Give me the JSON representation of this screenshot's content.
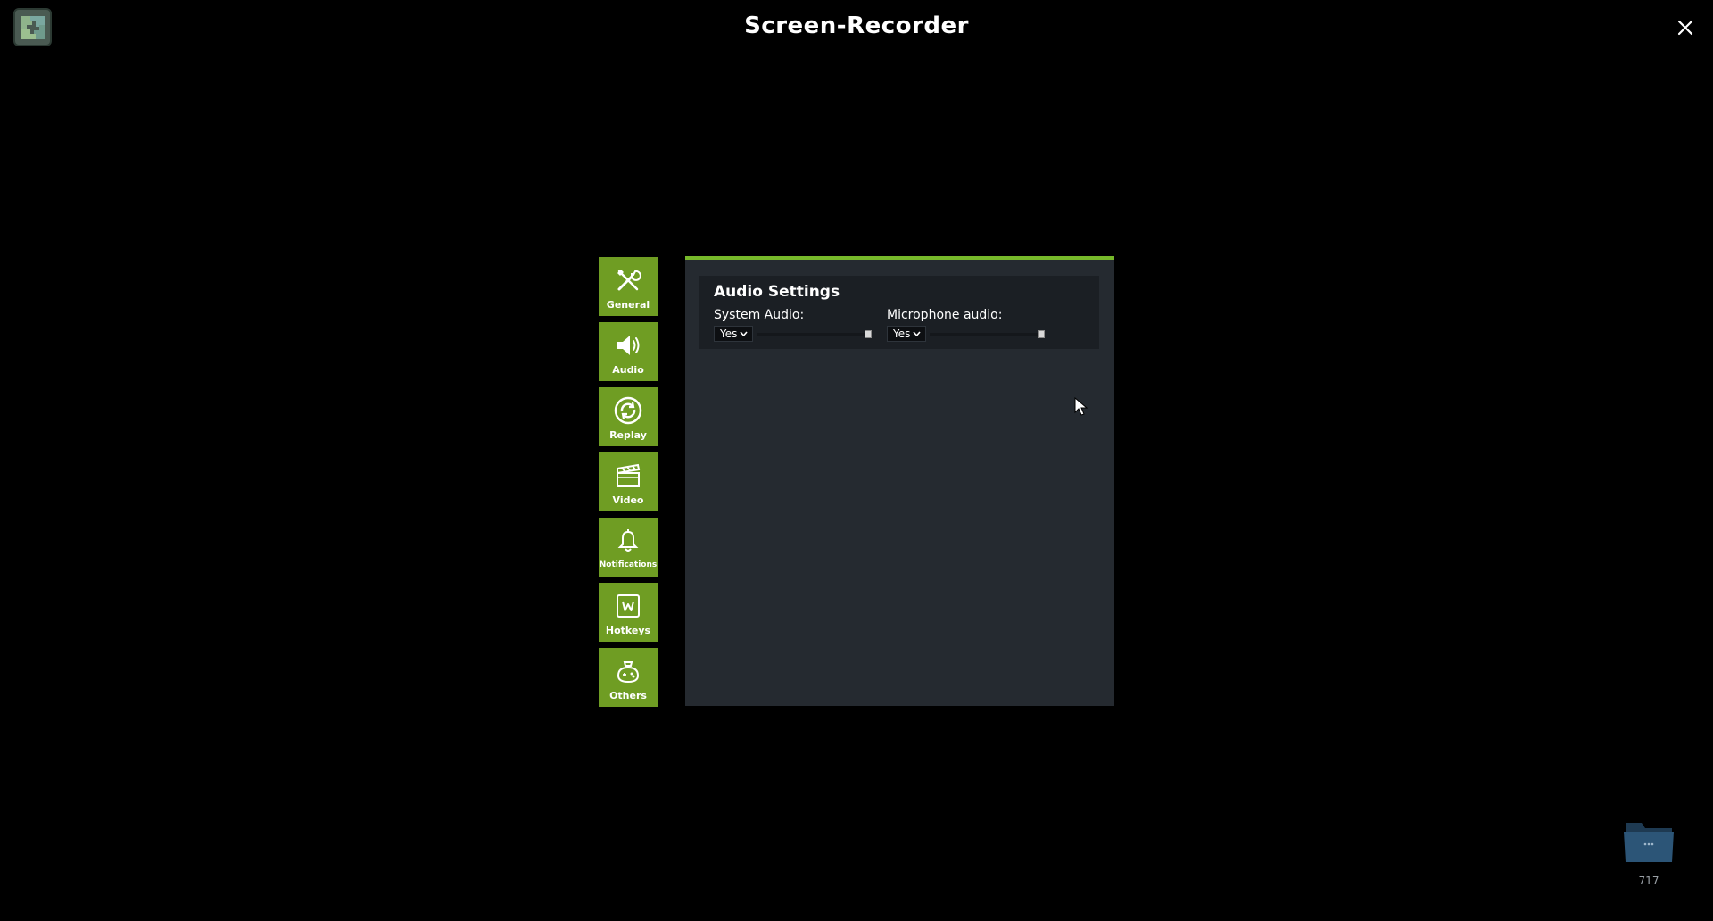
{
  "window": {
    "title": "Screen-Recorder"
  },
  "nav": {
    "items": [
      {
        "label": "General",
        "icon": "tools-icon"
      },
      {
        "label": "Audio",
        "icon": "speaker-icon"
      },
      {
        "label": "Replay",
        "icon": "replay-icon"
      },
      {
        "label": "Video",
        "icon": "clapperboard-icon"
      },
      {
        "label": "Notifications",
        "icon": "bell-icon"
      },
      {
        "label": "Hotkeys",
        "icon": "keyboard-key-icon"
      },
      {
        "label": "Others",
        "icon": "gamepad-icon"
      }
    ]
  },
  "audio_settings": {
    "title": "Audio Settings",
    "system_audio": {
      "label": "System Audio:",
      "value": "Yes",
      "volume_fraction": 1.0
    },
    "microphone_audio": {
      "label": "Microphone audio:",
      "value": "Yes",
      "volume_fraction": 1.0
    }
  },
  "folder": {
    "count": "717"
  },
  "colors": {
    "accent": "#76b82a",
    "nav_bg": "#6f9d23",
    "panel_bg": "#252a30",
    "section_bg": "#1b1f24"
  }
}
